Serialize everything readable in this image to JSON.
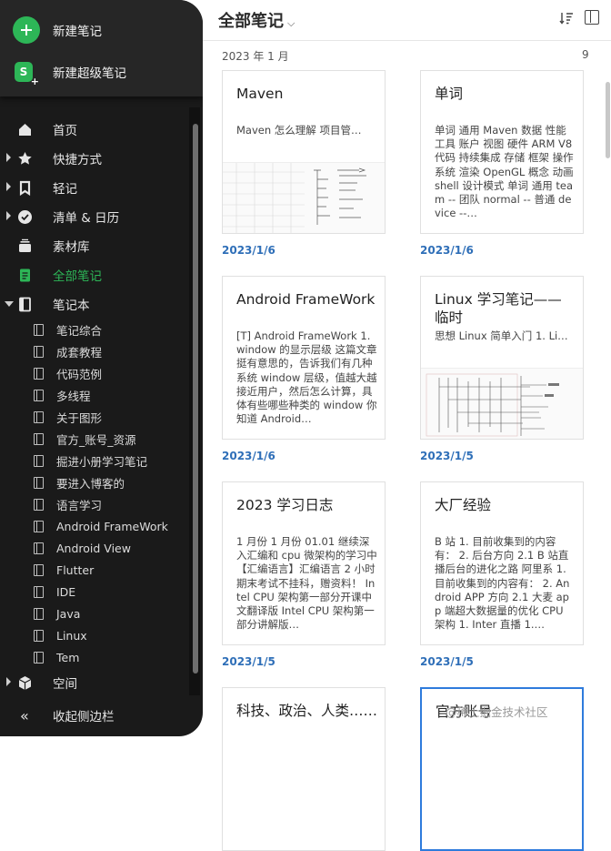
{
  "sidebar": {
    "new_note": "新建笔记",
    "new_super_note": "新建超级笔记",
    "super_note_icon_letter": "S",
    "nav": [
      {
        "label": "首页",
        "icon": "home-icon"
      },
      {
        "label": "快捷方式",
        "icon": "star-icon"
      },
      {
        "label": "轻记",
        "icon": "quick-note-icon"
      },
      {
        "label": "清单 & 日历",
        "icon": "checklist-icon"
      },
      {
        "label": "素材库",
        "icon": "library-icon"
      },
      {
        "label": "全部笔记",
        "icon": "all-notes-icon"
      },
      {
        "label": "笔记本",
        "icon": "notebook-icon"
      }
    ],
    "notebooks": [
      "笔记综合",
      "成套教程",
      "代码范例",
      "多线程",
      "关于图形",
      "官方_账号_资源",
      "掘进小册学习笔记",
      "要进入博客的",
      "语言学习",
      "Android FrameWork",
      "Android View",
      "Flutter",
      "IDE",
      "Java",
      "Linux",
      "Tem"
    ],
    "space": "空间",
    "collapse": "收起侧边栏"
  },
  "header": {
    "title": "全部笔记",
    "month": "2023 年 1 月",
    "count": "9"
  },
  "notes": [
    {
      "title": "Maven",
      "snippet": "Maven 怎么理解 项目管…",
      "date": "2023/1/6"
    },
    {
      "title": "单词",
      "snippet": "单词 通用 Maven 数据 性能 工具 账户 视图 硬件 ARM V8 代码 持续集成 存储 框架 操作系统 渲染 OpenGL 概念 动画 shell 设计模式 单词 通用 team -- 团队 normal -- 普通 device --…",
      "date": "2023/1/6"
    },
    {
      "title": "Android FrameWork",
      "snippet": "[T] Android FrameWork 1. window 的显示层级 这篇文章挺有意思的，告诉我们有几种系统 window 层级，值越大越接近用户，然后怎么计算，具体有些哪些种类的 window 你知道 Android…",
      "date": "2023/1/6"
    },
    {
      "title": "Linux 学习笔记——临时",
      "snippet": "思想 Linux 简单入门 1. Li…",
      "date": "2023/1/5"
    },
    {
      "title": "2023 学习日志",
      "snippet": "1 月份 1 月份 01.01 继续深入汇编和 cpu 微架构的学习中 【汇编语言】汇编语言 2 小时期末考试不挂科，赠资料！ Intel CPU 架构第一部分开课中文翻译版 Intel CPU 架构第一部分讲解版…",
      "date": "2023/1/5"
    },
    {
      "title": "大厂经验",
      "snippet": "B 站 1. 目前收集到的内容有： 2. 后台方向 2.1 B 站直播后台的进化之路 阿里系 1. 目前收集到的内容有： 2. Android APP 方向 2.1 大麦 app 端超大数据量的优化 CPU 架构 1. Inter 直播 1.…",
      "date": "2023/1/5"
    },
    {
      "title": "科技、政治、人类……",
      "snippet": "",
      "date": ""
    },
    {
      "title": "官方账号",
      "snippet": "",
      "date": ""
    }
  ],
  "watermark": "@稀土掘金技术社区",
  "colors": {
    "accent_green": "#2db657",
    "date_blue": "#2f6fb8",
    "selected_border": "#2e7bdc",
    "sidebar_bg": "#1a1a1a"
  }
}
